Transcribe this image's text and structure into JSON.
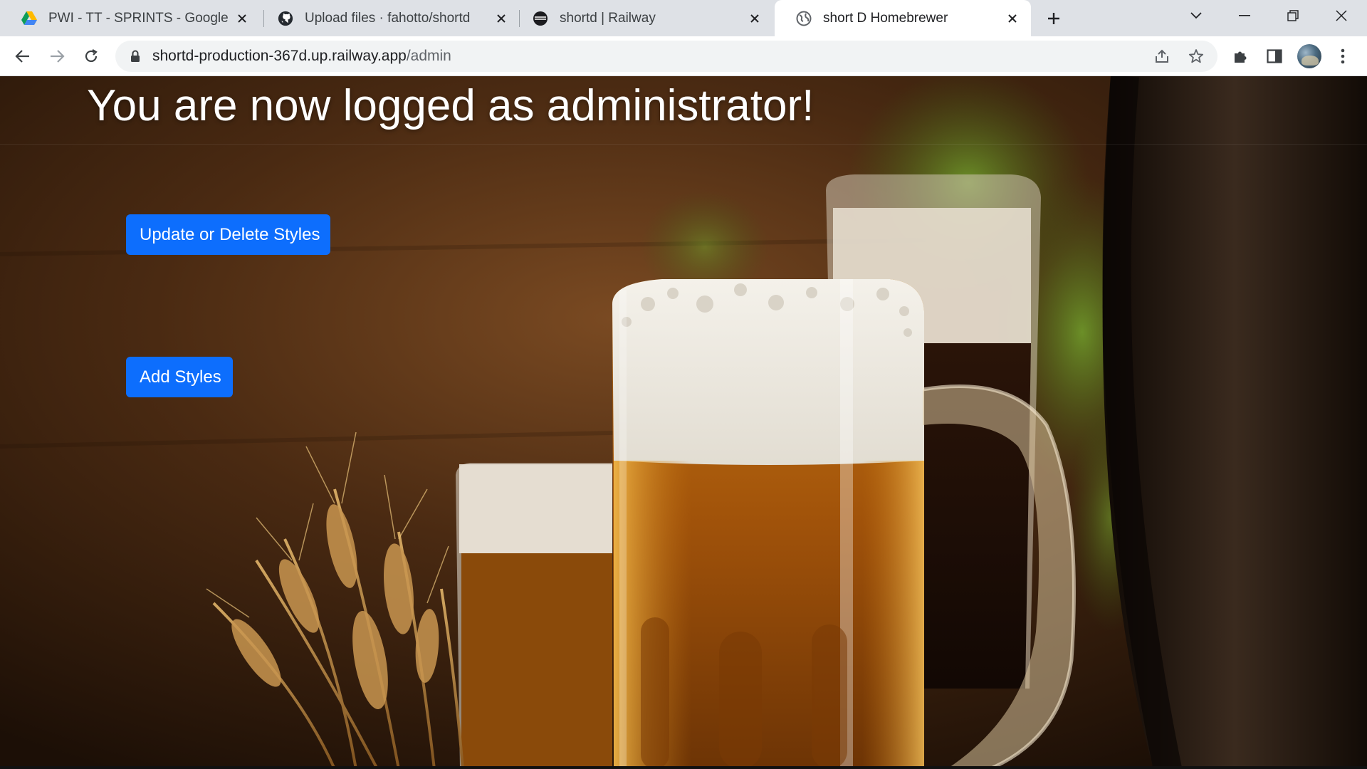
{
  "browser": {
    "tabs": [
      {
        "title": "PWI - TT - SPRINTS - Google Driv",
        "icon": "google-drive-icon",
        "active": false
      },
      {
        "title": "Upload files · fahotto/shortd",
        "icon": "github-icon",
        "active": false
      },
      {
        "title": "shortd | Railway",
        "icon": "railway-icon",
        "active": false
      },
      {
        "title": "short D Homebrewer",
        "icon": "globe-icon",
        "active": true
      }
    ],
    "address": {
      "host": "shortd-production-367d.up.railway.app",
      "path": "/admin"
    }
  },
  "page": {
    "title": "You are now logged as administrator!",
    "buttons": {
      "update_delete": "Update or Delete Styles",
      "add": "Add Styles"
    },
    "colors": {
      "primary_button": "#0d6efd",
      "title_text": "#ffffff"
    },
    "background_image": "beer-mugs-wheat-barrel-photo"
  }
}
